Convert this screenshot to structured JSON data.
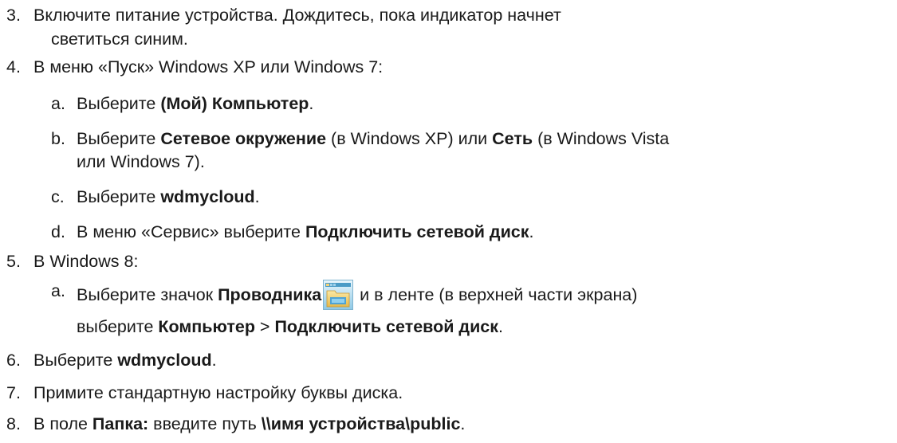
{
  "steps": {
    "s3": {
      "num": "3.",
      "line1": "Включите питание устройства. Дождитесь, пока индикатор начнет",
      "line2": "светиться синим."
    },
    "s4": {
      "num": "4.",
      "text": "В меню «Пуск» Windows XP или Windows 7:",
      "a": {
        "letter": "a.",
        "pre": "Выберите ",
        "bold": "(Мой) Компьютер",
        "post": "."
      },
      "b": {
        "letter": "b.",
        "pre": "Выберите ",
        "bold1": "Сетевое окружение",
        "mid": " (в Windows XP) или ",
        "bold2": "Сеть",
        "post": " (в Windows Vista",
        "line2": "или Windows 7)."
      },
      "c": {
        "letter": "c.",
        "pre": "Выберите ",
        "bold": "wdmycloud",
        "post": "."
      },
      "d": {
        "letter": "d.",
        "pre": "В меню «Сервис» выберите ",
        "bold": "Подключить сетевой диск",
        "post": "."
      }
    },
    "s5": {
      "num": "5.",
      "text": "В Windows 8:",
      "a": {
        "letter": "a.",
        "pre": "Выберите значок ",
        "bold": "Проводника",
        "icon": "file-explorer-icon",
        "post": " и в ленте (в верхней части экрана)",
        "line2_pre": "выберите ",
        "line2_bold1": "Компьютер",
        "line2_mid": " > ",
        "line2_bold2": "Подключить сетевой диск",
        "line2_post": "."
      }
    },
    "s6": {
      "num": "6.",
      "pre": "Выберите ",
      "bold": "wdmycloud",
      "post": "."
    },
    "s7": {
      "num": "7.",
      "text": "Примите стандартную настройку буквы диска."
    },
    "s8": {
      "num": "8.",
      "pre": "В поле ",
      "bold1": "Папка:",
      "mid": " введите путь ",
      "bold2": "\\\\имя устройства\\public",
      "post": "."
    }
  }
}
